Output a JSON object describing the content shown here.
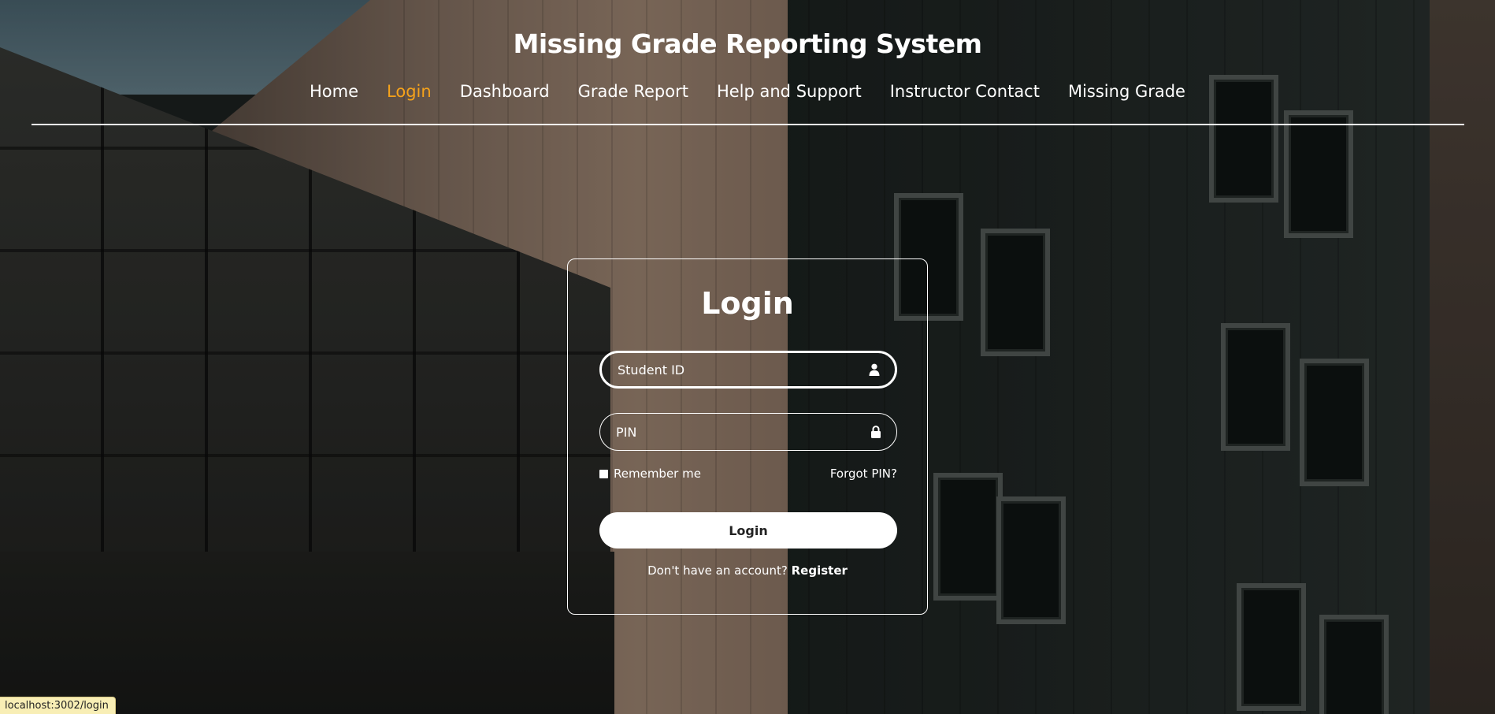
{
  "header": {
    "title": "Missing Grade Reporting System",
    "nav": [
      {
        "label": "Home",
        "active": false
      },
      {
        "label": "Login",
        "active": true
      },
      {
        "label": "Dashboard",
        "active": false
      },
      {
        "label": "Grade Report",
        "active": false
      },
      {
        "label": "Help and Support",
        "active": false
      },
      {
        "label": "Instructor Contact",
        "active": false
      },
      {
        "label": "Missing Grade",
        "active": false
      }
    ]
  },
  "login": {
    "title": "Login",
    "student_id": {
      "placeholder": "Student ID",
      "value": "",
      "icon": "user-icon"
    },
    "pin": {
      "placeholder": "PIN",
      "value": "",
      "icon": "lock-icon"
    },
    "remember_label": "Remember me",
    "forgot_label": "Forgot PIN?",
    "submit_label": "Login",
    "register_prompt": "Don't have an account?",
    "register_label": "Register"
  },
  "status_bar": {
    "url": "localhost:3002/login"
  },
  "colors": {
    "accent": "#f5a21b",
    "text": "#ffffff"
  }
}
